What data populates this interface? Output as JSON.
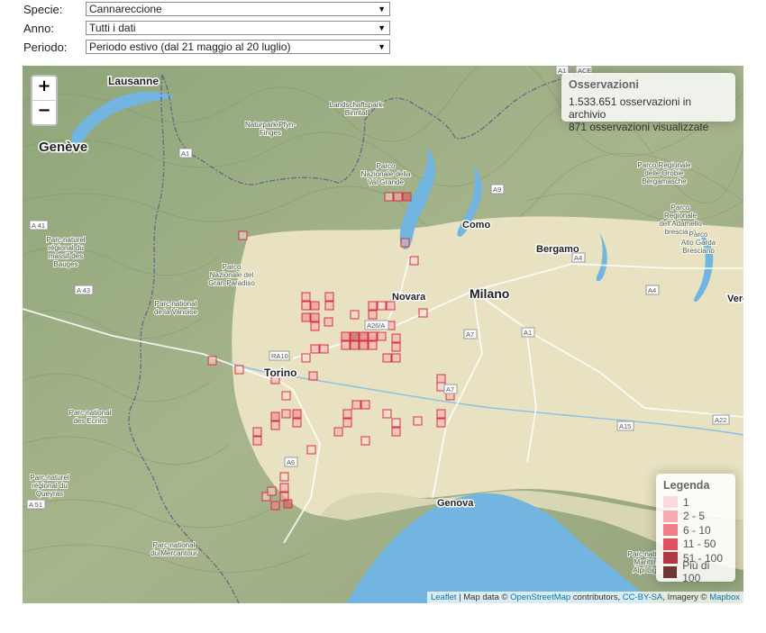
{
  "filters": {
    "species": {
      "label": "Specie:",
      "value": "Cannareccione"
    },
    "year": {
      "label": "Anno:",
      "value": "Tutti i dati"
    },
    "period": {
      "label": "Periodo:",
      "value": "Periodo estivo (dal 21 maggio al 20 luglio)"
    }
  },
  "map": {
    "zoom_in": "+",
    "zoom_out": "−",
    "places": {
      "lausanne": "Lausanne",
      "geneve": "Genève",
      "como": "Como",
      "bergamo": "Bergamo",
      "novara": "Novara",
      "milano": "Milano",
      "torino": "Torino",
      "genova": "Genova",
      "vero": "Vero"
    },
    "parks": {
      "pfyn_1": "Naturpark Pfyn-",
      "pfyn_2": "Finges",
      "binntal_1": "Landschaftspark",
      "binntal_2": "Binntal",
      "valgrande_1": "Parco",
      "valgrande_2": "Nazionale della",
      "valgrande_3": "Val Grande",
      "orobie_1": "Parco Regionale",
      "orobie_2": "delle Orobie",
      "orobie_3": "Bergamasche",
      "adamello_1": "Parco",
      "adamello_2": "Regionale",
      "adamello_3": "dell'Adamello",
      "adamello_4": "bresciano",
      "alto_garda_1": "Parco",
      "alto_garda_2": "Alto Garda",
      "alto_garda_3": "Bresciano",
      "bauges_1": "Parc naturel",
      "bauges_2": "régional du",
      "bauges_3": "massif des",
      "bauges_4": "Bauges",
      "paradiso_1": "Parco",
      "paradiso_2": "Nazionale del",
      "paradiso_3": "Gran Paradiso",
      "vanoise_1": "Parc national",
      "vanoise_2": "de la Vanoise",
      "ecrins_1": "Parc national",
      "ecrins_2": "des Ecrins",
      "queyras_1": "Parc naturel",
      "queyras_2": "régional du",
      "queyras_3": "Queyras",
      "mercantour_1": "Parc national",
      "mercantour_2": "du Mercantour",
      "ligure_1": "Parc national",
      "ligure_2": "Marittime",
      "ligure_3": "Alpi Liguri"
    },
    "roads": {
      "a1_west": "A1",
      "a41": "A 41",
      "a43": "A 43",
      "ra10": "RA10",
      "a26a": "A26/A",
      "a4": "A4",
      "a4b": "A4",
      "a7": "A7",
      "a1": "A1",
      "a7b": "A7",
      "a15": "A15",
      "a22": "A22",
      "a6": "A6",
      "a51": "A 51",
      "a1n": "A1",
      "a9": "A9",
      "ace": "ACE"
    }
  },
  "observations": {
    "title": "Osservazioni",
    "archive": "1.533.651 osservazioni in archivio",
    "shown": "871 osservazioni visualizzate"
  },
  "legend": {
    "title": "Legenda",
    "items": [
      {
        "label": "1",
        "color": "#fcd9dd"
      },
      {
        "label": "2 - 5",
        "color": "#f7aab3"
      },
      {
        "label": "6 - 10",
        "color": "#ef7f8b"
      },
      {
        "label": "11 - 50",
        "color": "#e2515f"
      },
      {
        "label": "51 - 100",
        "color": "#b03a44"
      },
      {
        "label": "Più di 100",
        "color": "#6e3537"
      }
    ]
  },
  "attribution": {
    "leaflet": "Leaflet",
    "sep": " | Map data © ",
    "osm": "OpenStreetMap",
    "contrib": " contributors, ",
    "ccbysa": "CC-BY-SA",
    "imagery": ", Imagery © ",
    "mapbox": "Mapbox"
  }
}
